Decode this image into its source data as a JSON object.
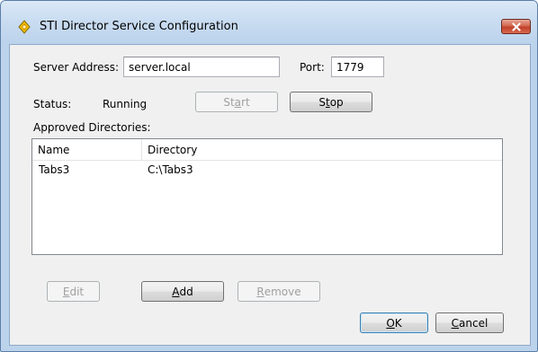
{
  "window": {
    "title": "STI Director Service Configuration",
    "title_icon": "sti-director-icon",
    "close_icon": "close-icon"
  },
  "server": {
    "address_label": "Server Address:",
    "address_value": "server.local",
    "port_label": "Port:",
    "port_value": "1779"
  },
  "status": {
    "label": "Status:",
    "value": "Running",
    "start_before": "St",
    "start_mnemonic": "a",
    "start_after": "rt",
    "start_enabled": false,
    "stop_before": "S",
    "stop_mnemonic": "t",
    "stop_after": "op",
    "stop_enabled": true
  },
  "directories": {
    "label": "Approved Directories:",
    "columns": [
      "Name",
      "Directory"
    ],
    "rows": [
      {
        "name": "Tabs3",
        "directory": "C:\\Tabs3"
      }
    ]
  },
  "list_buttons": {
    "edit": {
      "mnemonic": "E",
      "rest": "dit",
      "enabled": false
    },
    "add": {
      "mnemonic": "A",
      "rest": "dd",
      "enabled": true
    },
    "remove": {
      "mnemonic": "R",
      "rest": "emove",
      "enabled": false
    }
  },
  "dialog_buttons": {
    "ok": {
      "mnemonic": "O",
      "rest": "K"
    },
    "cancel": {
      "mnemonic": "C",
      "rest": "ancel"
    }
  },
  "colors": {
    "frame": "#bcd3ec",
    "client": "#f0f0f0",
    "close_button": "#c1402a",
    "default_button_border": "#3c7fb1"
  }
}
